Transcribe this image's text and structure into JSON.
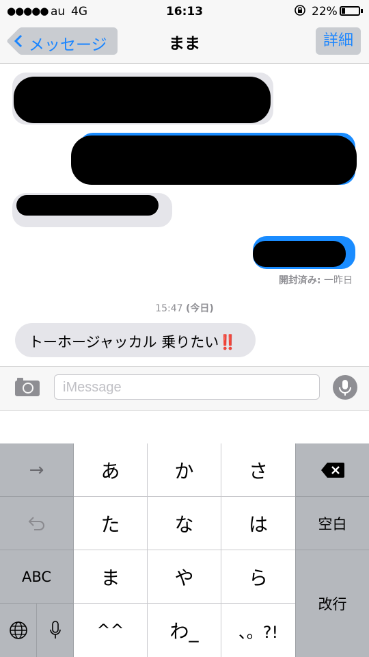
{
  "status_bar": {
    "signal": "●●●●●",
    "carrier": "au",
    "network": "4G",
    "time": "16:13",
    "battery": "22%",
    "battery_level": 0.22
  },
  "nav": {
    "back_label": "メッセージ",
    "title": "まま",
    "details_label": "詳細"
  },
  "conversation": {
    "read_receipt_label": "開封済み:",
    "read_receipt_time": "一昨日",
    "timestamp_time": "15:47",
    "timestamp_day": "(今日)",
    "last_message_text": "トーホージャッカル 乗りたい",
    "last_message_emoji": "‼️"
  },
  "composer": {
    "placeholder": "iMessage",
    "value": ""
  },
  "keyboard": {
    "arrow": "→",
    "undo": "↶",
    "abc": "ABC",
    "globe": "globe-icon",
    "mic": "mic-icon",
    "keys_row1": [
      "あ",
      "か",
      "さ"
    ],
    "keys_row2": [
      "た",
      "な",
      "は"
    ],
    "keys_row3": [
      "ま",
      "や",
      "ら"
    ],
    "keys_row4": [
      "^^",
      "わ_",
      "、。?!"
    ],
    "delete": "delete-icon",
    "space": "空白",
    "enter": "改行"
  },
  "colors": {
    "accent": "#1a85ff",
    "incoming_bubble": "#e5e5ea",
    "outgoing_bubble": "#1a8cff",
    "keyboard_bg": "#b5b8bd"
  }
}
